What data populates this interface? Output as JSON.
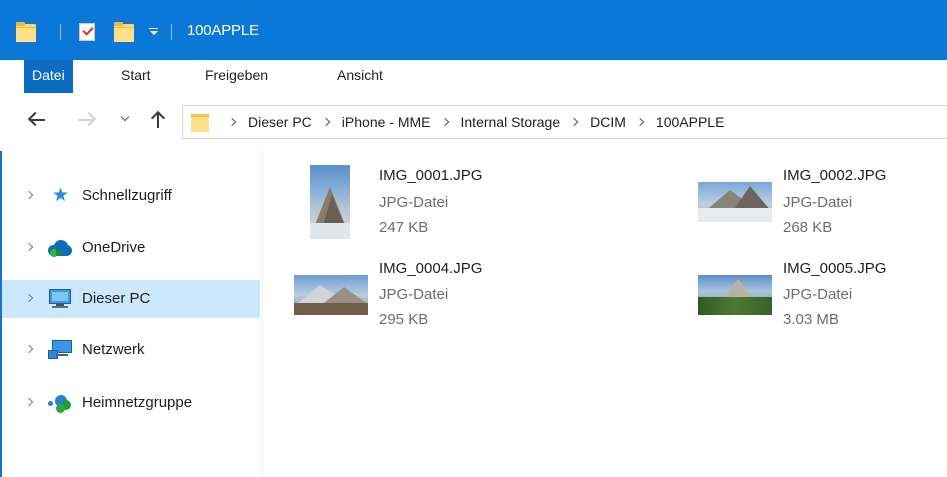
{
  "window": {
    "title": "100APPLE"
  },
  "ribbon": {
    "tabs": [
      {
        "label": "Datei",
        "active": true
      },
      {
        "label": "Start",
        "active": false
      },
      {
        "label": "Freigeben",
        "active": false
      },
      {
        "label": "Ansicht",
        "active": false
      }
    ]
  },
  "address": {
    "crumbs": [
      "Dieser PC",
      "iPhone - MME",
      "Internal Storage",
      "DCIM",
      "100APPLE"
    ]
  },
  "navpane": {
    "items": [
      {
        "label": "Schnellzugriff",
        "icon": "star-icon",
        "selected": false
      },
      {
        "label": "OneDrive",
        "icon": "cloud-icon",
        "selected": false
      },
      {
        "label": "Dieser PC",
        "icon": "pc-icon",
        "selected": true
      },
      {
        "label": "Netzwerk",
        "icon": "network-icon",
        "selected": false
      },
      {
        "label": "Heimnetzgruppe",
        "icon": "homegroup-icon",
        "selected": false
      }
    ]
  },
  "files": [
    {
      "name": "IMG_0001.JPG",
      "type": "JPG-Datei",
      "size": "247 KB"
    },
    {
      "name": "IMG_0002.JPG",
      "type": "JPG-Datei",
      "size": "268 KB"
    },
    {
      "name": "IMG_0004.JPG",
      "type": "JPG-Datei",
      "size": "295 KB"
    },
    {
      "name": "IMG_0005.JPG",
      "type": "JPG-Datei",
      "size": "3.03 MB"
    }
  ],
  "colors": {
    "titlebar": "#0b78d7",
    "active_tab": "#0b6cc4",
    "selection": "#cce8ff"
  }
}
